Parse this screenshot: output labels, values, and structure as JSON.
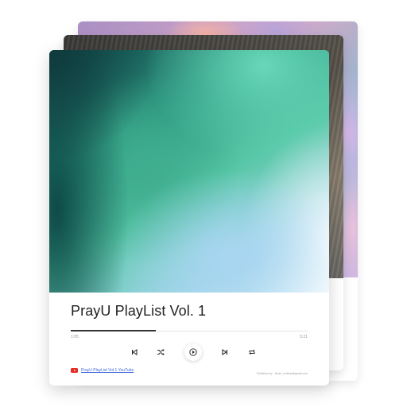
{
  "player": {
    "title": "PrayU PlayList Vol. 1",
    "current_time": "1:05",
    "total_time": "5:21",
    "progress": 0.36,
    "link_label": "PrayU PlayList Vol.1 YouTube",
    "credit": "Published by : Dean_chritme@gmail.com"
  },
  "controls": [
    {
      "name": "previous-button",
      "icon": "skip-back-icon"
    },
    {
      "name": "shuffle-button",
      "icon": "shuffle-icon"
    },
    {
      "name": "play-button",
      "icon": "play-icon"
    },
    {
      "name": "next-button",
      "icon": "skip-forward-icon"
    },
    {
      "name": "repeat-button",
      "icon": "repeat-icon"
    }
  ],
  "colors": {
    "youtube": "#e52d27",
    "link": "#3f6ad8",
    "progress": "#333333"
  }
}
